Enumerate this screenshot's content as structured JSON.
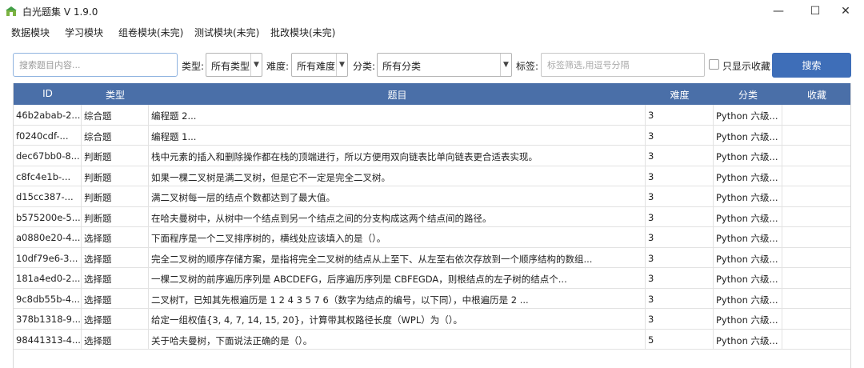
{
  "window": {
    "title": "白光题集 V 1.9.0",
    "minimize_glyph": "—",
    "maximize_glyph": "☐",
    "close_glyph": "✕"
  },
  "menu": [
    "数据模块",
    "学习模块",
    "组卷模块(未完)",
    "测试模块(未完)",
    "批改模块(未完)"
  ],
  "filters": {
    "search_placeholder": "搜索题目内容...",
    "type_label": "类型:",
    "type_value": "所有类型",
    "difficulty_label": "难度:",
    "difficulty_value": "所有难度",
    "category_label": "分类:",
    "category_value": "所有分类",
    "tags_label": "标签:",
    "tags_placeholder": "标签筛选,用逗号分隔",
    "favorites_only_label": "只显示收藏",
    "search_button": "搜索"
  },
  "table": {
    "columns": [
      "ID",
      "类型",
      "题目",
      "难度",
      "分类",
      "收藏"
    ],
    "rows": [
      {
        "id": "46b2abab-2...",
        "type": "综合题",
        "question": "编程题 2...",
        "difficulty": "3",
        "category": "Python 六级...",
        "favorite": false
      },
      {
        "id": "f0240cdf-...",
        "type": "综合题",
        "question": "编程题 1...",
        "difficulty": "3",
        "category": "Python 六级...",
        "favorite": false
      },
      {
        "id": "dec67bb0-8...",
        "type": "判断题",
        "question": "栈中元素的插入和删除操作都在栈的顶端进行，所以方便用双向链表比单向链表更合适表实现。",
        "difficulty": "3",
        "category": "Python 六级...",
        "favorite": false
      },
      {
        "id": "c8fc4e1b-...",
        "type": "判断题",
        "question": "如果一棵二叉树是满二叉树，但是它不一定是完全二叉树。",
        "difficulty": "3",
        "category": "Python 六级...",
        "favorite": false
      },
      {
        "id": "d15cc387-...",
        "type": "判断题",
        "question": "满二叉树每一层的结点个数都达到了最大值。",
        "difficulty": "3",
        "category": "Python 六级...",
        "favorite": false
      },
      {
        "id": "b575200e-5...",
        "type": "判断题",
        "question": "在哈夫曼树中，从树中一个结点到另一个结点之间的分支构成这两个结点间的路径。",
        "difficulty": "3",
        "category": "Python 六级...",
        "favorite": false
      },
      {
        "id": "a0880e20-4...",
        "type": "选择题",
        "question": "下面程序是一个二叉排序树的，横线处应该填入的是（）。",
        "difficulty": "3",
        "category": "Python 六级...",
        "favorite": false
      },
      {
        "id": "10df79e6-3...",
        "type": "选择题",
        "question": "完全二叉树的顺序存储方案，是指将完全二叉树的结点从上至下、从左至右依次存放到一个顺序结构的数组...",
        "difficulty": "3",
        "category": "Python 六级...",
        "favorite": false
      },
      {
        "id": "181a4ed0-2...",
        "type": "选择题",
        "question": "一棵二叉树的前序遍历序列是 ABCDEFG，后序遍历序列是 CBFEGDA，则根结点的左子树的结点个...",
        "difficulty": "3",
        "category": "Python 六级...",
        "favorite": false
      },
      {
        "id": "9c8db55b-4...",
        "type": "选择题",
        "question": "二叉树T，已知其先根遍历是 1 2 4 3 5 7 6（数字为结点的编号，以下同），中根遍历是 2 ...",
        "difficulty": "3",
        "category": "Python 六级...",
        "favorite": false
      },
      {
        "id": "378b1318-9...",
        "type": "选择题",
        "question": "给定一组权值{3, 4, 7, 14, 15, 20}，计算带其权路径长度（WPL）为（）。",
        "difficulty": "3",
        "category": "Python 六级...",
        "favorite": false
      },
      {
        "id": "98441313-4...",
        "type": "选择题",
        "question": "关于哈夫曼树，下面说法正确的是（）。",
        "difficulty": "5",
        "category": "Python 六级...",
        "favorite": false
      }
    ]
  },
  "colors": {
    "header_bg": "#4a6fa8",
    "search_button_bg": "#3e6eb8",
    "app_icon": "#4caf50"
  },
  "icons": {
    "app": "app-logo-icon",
    "dropdown": "chevron-down-icon"
  }
}
